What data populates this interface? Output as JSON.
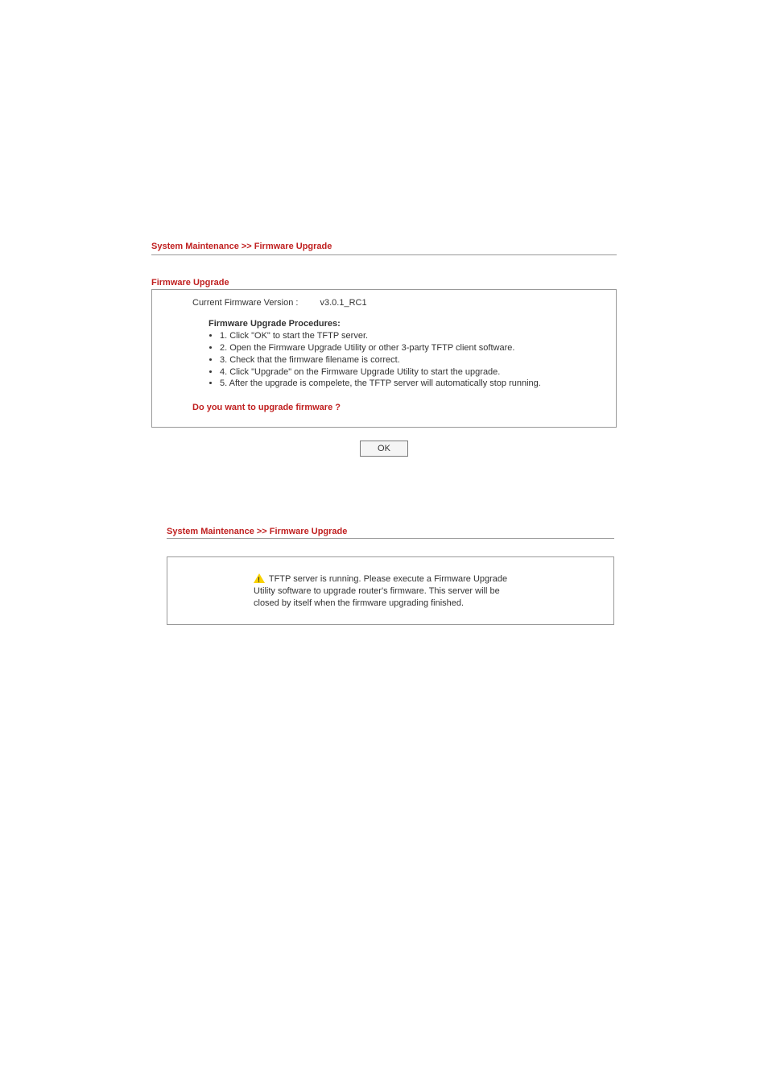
{
  "page1": {
    "breadcrumb": "System Maintenance >> Firmware Upgrade",
    "section_title": "Firmware Upgrade",
    "version_label": "Current Firmware Version :",
    "version_value": "v3.0.1_RC1",
    "procedures_title": "Firmware Upgrade Procedures:",
    "steps": [
      "1. Click \"OK\" to start the TFTP server.",
      "2. Open the Firmware Upgrade Utility or other 3-party TFTP client software.",
      "3. Check that the firmware filename is correct.",
      "4. Click \"Upgrade\" on the Firmware Upgrade Utility to start the upgrade.",
      "5. After the upgrade is compelete, the TFTP server will automatically stop running."
    ],
    "confirm_text": "Do you want to upgrade firmware ?",
    "ok_label": "OK"
  },
  "page2": {
    "breadcrumb": "System Maintenance >> Firmware Upgrade",
    "notice": " TFTP server is running. Please execute a Firmware Upgrade Utility software to upgrade router's firmware. This server will be closed by itself when the firmware upgrading finished."
  }
}
